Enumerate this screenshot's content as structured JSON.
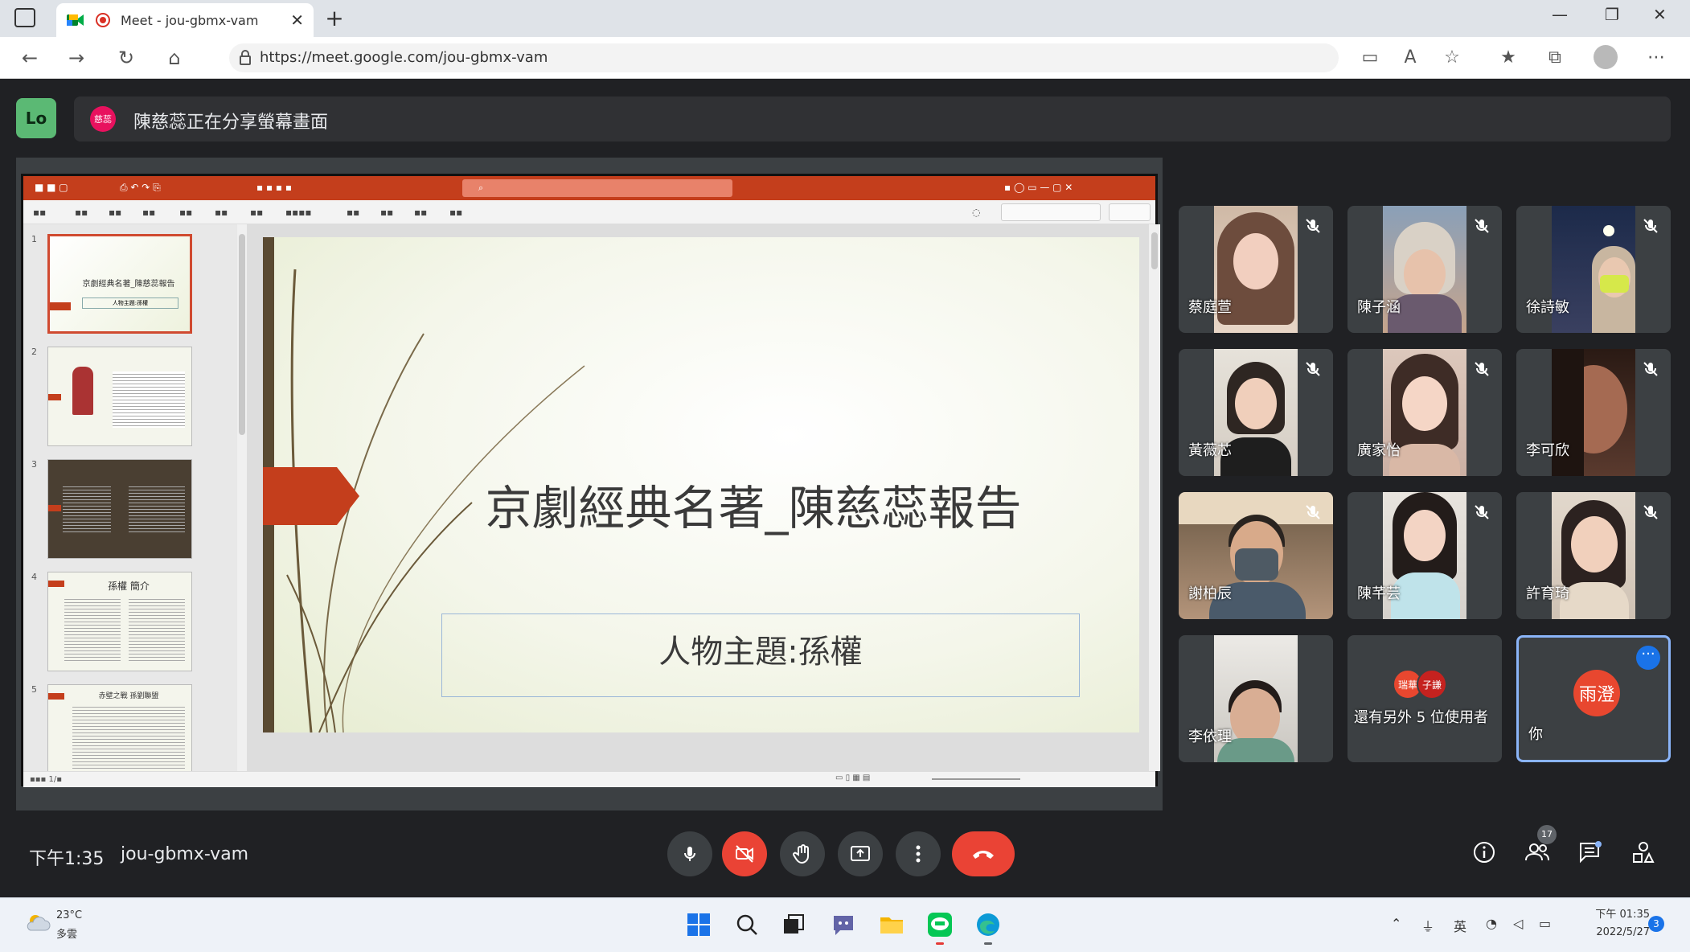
{
  "browser": {
    "tab_title": "Meet - jou-gbmx-vam",
    "url": "https://meet.google.com/jou-gbmx-vam"
  },
  "meet": {
    "badge": "Lo",
    "presenter_chip": "慈蕊",
    "banner_text": "陳慈蕊正在分享螢幕畫面"
  },
  "slide": {
    "title": "京劇經典名著_陳慈蕊報告",
    "subtitle": "人物主題:孫權",
    "thumb1_title": "京劇經典名著_陳慈蕊報告",
    "thumb1_sub": "人物主題:孫權",
    "thumb4_title": "孫權 簡介",
    "thumb5_title": "赤壁之戰 孫劉聯盟",
    "thumb_numbers": [
      "1",
      "2",
      "3",
      "4",
      "5"
    ]
  },
  "participants": [
    {
      "name": "蔡庭萱"
    },
    {
      "name": "陳子涵"
    },
    {
      "name": "徐詩敏"
    },
    {
      "name": "黃薇芯"
    },
    {
      "name": "廣家怡"
    },
    {
      "name": "李可欣"
    },
    {
      "name": "謝柏辰"
    },
    {
      "name": "陳芊芸"
    },
    {
      "name": "許育琦"
    },
    {
      "name": "李依理"
    }
  ],
  "others_tile": {
    "avatar1": "瑞華",
    "avatar2": "子謙",
    "label": "還有另外 5 位使用者"
  },
  "self_tile": {
    "avatar": "雨澄",
    "label": "你"
  },
  "bottom_bar": {
    "time": "下午1:35",
    "meeting_code": "jou-gbmx-vam",
    "participant_count": "17"
  },
  "taskbar": {
    "temp": "23°C",
    "weather_text": "多雲",
    "ime": "英",
    "clock_time": "下午 01:35",
    "clock_date": "2022/5/27",
    "notifications": "3"
  },
  "colors": {
    "meet_bg": "#202124",
    "tile_bg": "#3c4043",
    "hangup_red": "#ea4335",
    "ppt_orange": "#c43e1c",
    "self_border": "#8ab4f8"
  }
}
